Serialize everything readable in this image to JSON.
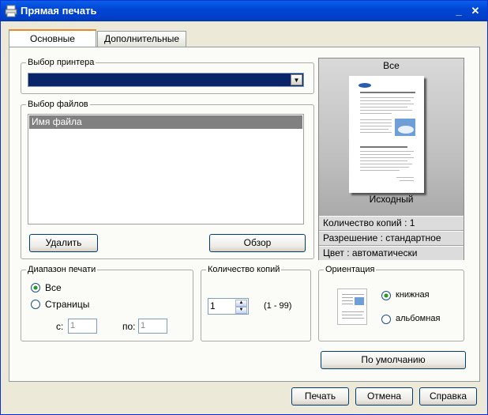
{
  "window": {
    "title": "Прямая печать",
    "minimize": "_",
    "close": "✕"
  },
  "tabs": [
    {
      "label": "Основные"
    },
    {
      "label": "Дополнительные"
    }
  ],
  "printer": {
    "legend": "Выбор принтера"
  },
  "files": {
    "legend": "Выбор файлов",
    "column_header": "Имя файла",
    "delete_label": "Удалить",
    "browse_label": "Обзор"
  },
  "preview": {
    "top_label": "Все",
    "bottom_label": "Исходный",
    "copies_info": "Количество копий : 1",
    "resolution_info": "Разрешение : стандартное",
    "color_info": "Цвет : автоматически"
  },
  "range": {
    "legend": "Диапазон печати",
    "all_label": "Все",
    "pages_label": "Страницы",
    "from_label": "с:",
    "from_value": "1",
    "to_label": "по:",
    "to_value": "1"
  },
  "copies": {
    "legend": "Количество копий",
    "value": "1",
    "range_hint": "(1 - 99)"
  },
  "orientation": {
    "legend": "Ориентация",
    "portrait_label": "книжная",
    "landscape_label": "альбомная"
  },
  "defaults_label": "По умолчанию",
  "footer": {
    "print_label": "Печать",
    "cancel_label": "Отмена",
    "help_label": "Справка"
  },
  "colors": {
    "title_bar": "#0046d5",
    "selected_printer": "#0a246a",
    "list_header": "#808080",
    "tab_highlight": "#e68b2c"
  }
}
